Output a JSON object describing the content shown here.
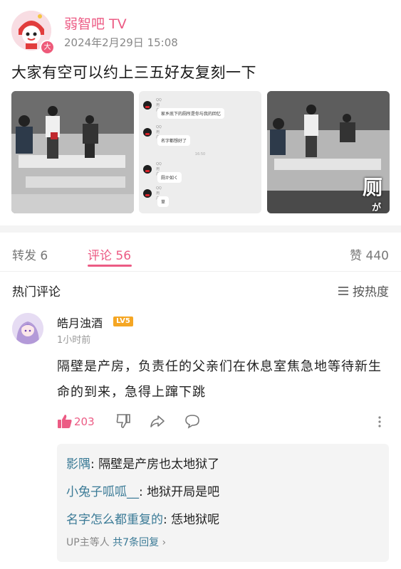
{
  "post": {
    "author": "弱智吧 TV",
    "date": "2024年2月29日 15:08",
    "badge": "大",
    "text": "大家有空可以约上三五好友复刻一下"
  },
  "images": {
    "chat": {
      "nick": "QQ用户",
      "messages": [
        "家乡底下的厕所是你与我的回忆",
        "名字都想好了",
        "厕か如く",
        "草"
      ],
      "time": "16:50"
    },
    "overlay": "厕",
    "overlay2": "が"
  },
  "tabs": {
    "repost": "转发 6",
    "comment": "评论 56",
    "like": "赞 440"
  },
  "hot_label": "热门评论",
  "sort_label": "按热度",
  "comment": {
    "user": "皓月浊酒",
    "level": "LV5",
    "time": "1小时前",
    "text": "隔壁是产房，负责任的父亲们在休息室焦急地等待新生命的到来，急得上蹿下跳",
    "likes": "203"
  },
  "replies": [
    {
      "user": "影隅",
      "text": ": 隔壁是产房也太地狱了"
    },
    {
      "user": "小兔子呱呱__",
      "text": ": 地狱开局是吧"
    },
    {
      "user": "名字怎么都重复的",
      "text": ": 恁地狱呢"
    }
  ],
  "more_replies": {
    "prefix": "UP主等人",
    "count": "共7条回复",
    "chevron": "›"
  },
  "colors": {
    "accent": "#ec5b84",
    "link": "#3a7a96",
    "level": "#f5a623"
  }
}
